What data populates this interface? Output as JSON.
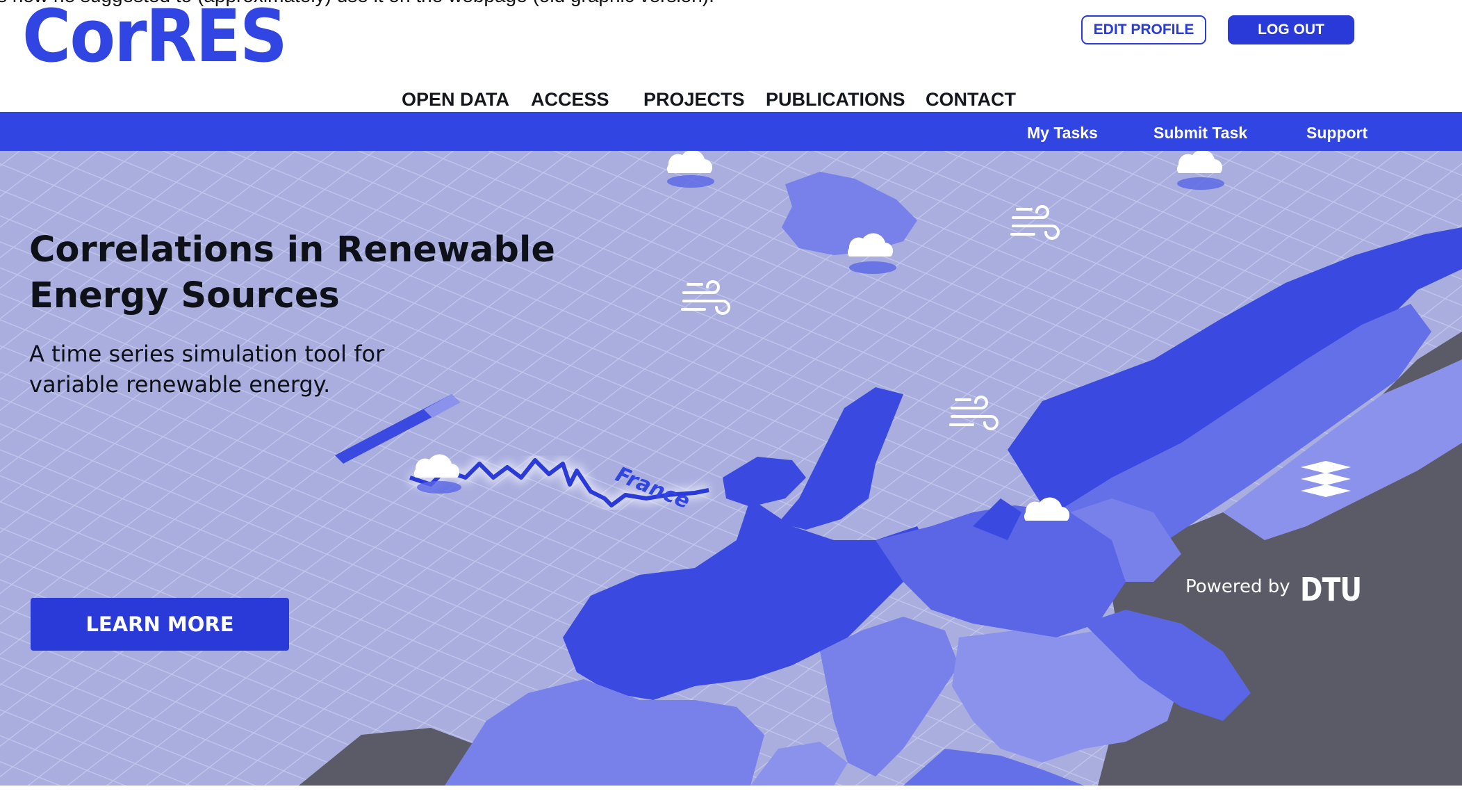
{
  "caption": "s how he suggested to (approximately) use it on the webpage (old graphic version):",
  "header": {
    "logo_text": "CorRES",
    "edit_profile_label": "EDIT PROFILE",
    "log_out_label": "LOG OUT"
  },
  "main_nav": [
    "OPEN DATA",
    "ACCESS",
    "PROJECTS",
    "PUBLICATIONS",
    "CONTACT"
  ],
  "sub_nav": [
    "My Tasks",
    "Submit Task",
    "Support"
  ],
  "hero": {
    "title": "Correlations in Renewable Energy Sources",
    "subtitle": "A time series simulation tool for variable renewable energy.",
    "cta_label": "LEARN MORE",
    "powered_by": "Powered by",
    "partner_logo_text": "DTU",
    "map_label": "France"
  },
  "colors": {
    "brand_blue": "#3145e3",
    "hero_background": "#a9aedf",
    "land_dark": "#5a5b66"
  },
  "icons": [
    "cloud-icon",
    "wind-icon",
    "dtu-logo-icon"
  ]
}
